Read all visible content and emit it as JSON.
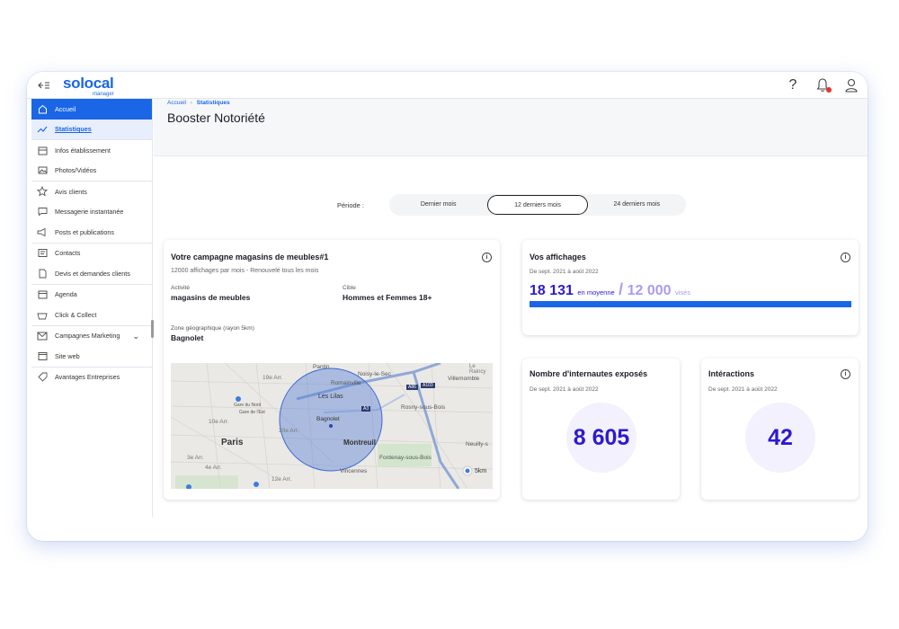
{
  "app": {
    "brand": "solocal",
    "brand_sub": "manager"
  },
  "topbar": {
    "help_icon": "?",
    "bell_icon": "bell-icon",
    "user_icon": "user-icon"
  },
  "sidebar": {
    "items": [
      {
        "label": "Accueil",
        "icon": "home-icon"
      },
      {
        "label": "Statistiques",
        "icon": "trend-icon"
      },
      {
        "label": "Infos établissement",
        "icon": "store-icon"
      },
      {
        "label": "Photos/Vidéos",
        "icon": "image-icon"
      },
      {
        "label": "Avis clients",
        "icon": "star-icon"
      },
      {
        "label": "Messagerie instantanée",
        "icon": "chat-icon"
      },
      {
        "label": "Posts et publications",
        "icon": "megaphone-icon"
      },
      {
        "label": "Contacts",
        "icon": "contact-card-icon"
      },
      {
        "label": "Devis et demandes clients",
        "icon": "document-icon"
      },
      {
        "label": "Agenda",
        "icon": "calendar-icon"
      },
      {
        "label": "Click & Collect",
        "icon": "basket-icon"
      },
      {
        "label": "Campagnes Marketing",
        "icon": "mail-icon"
      },
      {
        "label": "Site web",
        "icon": "website-icon"
      },
      {
        "label": "Avantages Entreprises",
        "icon": "tag-icon"
      }
    ]
  },
  "header": {
    "breadcrumb_home": "Accueil",
    "breadcrumb_sep": "›",
    "breadcrumb_current": "Statistiques",
    "title": "Booster Notoriété"
  },
  "period": {
    "label": "Période :",
    "options": [
      "Dernier mois",
      "12 derniers mois",
      "24 derniers mois"
    ],
    "selected": "12 derniers mois"
  },
  "campaign": {
    "title": "Votre campagne magasins de meubles#1",
    "subtitle": "12000 affichages par mois - Renouvelé tous les mois",
    "activity_label": "Activité",
    "activity_value": "magasins de meubles",
    "target_label": "Cible",
    "target_value": "Hommes et Femmes 18+",
    "zone_label": "Zone géographique (rayon 5km)",
    "zone_value": "Bagnolet",
    "map": {
      "places": [
        "Pantin",
        "Noisy-le-Sec",
        "Romainville",
        "Villemomble",
        "Les Lilas",
        "Bagnolet",
        "Montreuil",
        "Rosny-sous-Bois",
        "Paris",
        "Fontenay-sous-Bois",
        "Vincennes",
        "Neuilly-s",
        "Gare du Nord",
        "Gare de l'Est",
        "10e Arr.",
        "19e Arr.",
        "20e Arr.",
        "3e Arr.",
        "4e Arr.",
        "12e Arr.",
        "Le Raincy"
      ],
      "radius_label": "5km",
      "roads": [
        "A3",
        "A86",
        "A103"
      ]
    }
  },
  "impressions": {
    "title": "Vos affichages",
    "period": "De sept. 2021 à août 2022",
    "value": "18 131",
    "value_suffix": "en moyenne",
    "slash": "/",
    "target": "12 000",
    "target_suffix": "visés"
  },
  "reach": {
    "title": "Nombre d'internautes exposés",
    "period": "De sept. 2021 à août 2022",
    "value": "8 605"
  },
  "interactions": {
    "title": "Intéractions",
    "period": "De sept. 2021 à août 2022",
    "value": "42"
  },
  "colors": {
    "primary": "#1a66e6",
    "kpi": "#2d1ad1",
    "kpi_light": "#a99cf0"
  }
}
